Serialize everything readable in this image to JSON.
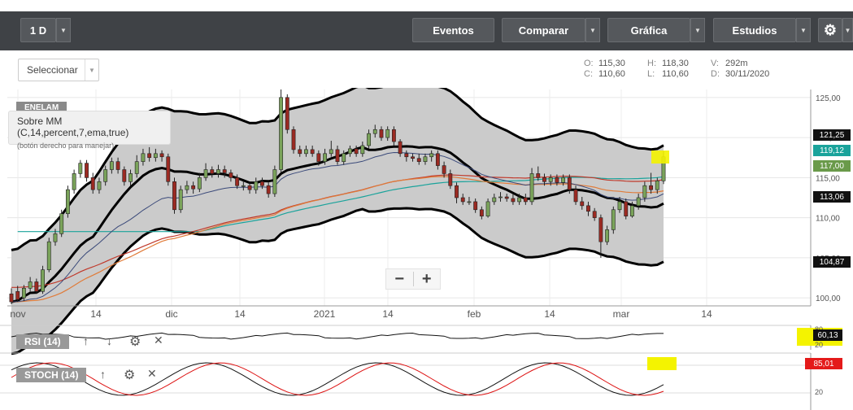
{
  "toolbar": {
    "interval": "1 D",
    "eventos": "Eventos",
    "comparar": "Comparar",
    "grafica": "Gráfica",
    "estudios": "Estudios"
  },
  "subbar": {
    "select_label": "Seleccionar",
    "ohlc": {
      "open_label": "O:",
      "open": "115,30",
      "high_label": "H:",
      "high": "118,30",
      "vol_label": "V:",
      "vol": "292m",
      "close_label": "C:",
      "close": "110,60",
      "low_label": "L:",
      "low": "110,60",
      "date_label": "D:",
      "date": "30/11/2020"
    }
  },
  "chart": {
    "symbol": "ENELAM",
    "tooltip_title": "Sobre MM (C,14,percent,7,ema,true)",
    "tooltip_hint": "(botón derecho para manejar)",
    "zoom_out": "−",
    "zoom_in": "+",
    "price_axis": [
      "125,00",
      "120,00",
      "115,00",
      "110,00",
      "105,00",
      "100,00"
    ],
    "date_axis": [
      "nov",
      "14",
      "dic",
      "14",
      "2021",
      "14",
      "feb",
      "14",
      "mar",
      "14"
    ],
    "price_tags": [
      {
        "label": "121,25",
        "color": "#111111"
      },
      {
        "label": "119,12",
        "color": "#1aa39b"
      },
      {
        "label": "117,00",
        "color": "#6a9a4a"
      },
      {
        "label": "113,06",
        "color": "#111111"
      },
      {
        "label": "104,87",
        "color": "#111111"
      }
    ]
  },
  "chart_data": {
    "type": "candlestick",
    "x_range": [
      "nov",
      "mar"
    ],
    "ylim": [
      99,
      126
    ],
    "candles": [
      [
        100.5,
        99.5,
        101.2,
        99.2
      ],
      [
        100.8,
        99.8,
        101.5,
        99.5
      ],
      [
        100.0,
        101.2,
        101.6,
        99.6
      ],
      [
        101.2,
        102.0,
        102.6,
        100.8
      ],
      [
        102.0,
        100.8,
        102.4,
        100.5
      ],
      [
        100.8,
        103.5,
        104.0,
        100.5
      ],
      [
        103.5,
        107.0,
        107.5,
        103.2
      ],
      [
        107.0,
        108.0,
        108.6,
        106.5
      ],
      [
        108.0,
        110.5,
        111.0,
        107.6
      ],
      [
        110.5,
        113.5,
        114.0,
        110.0
      ],
      [
        113.5,
        115.5,
        116.0,
        113.0
      ],
      [
        115.5,
        116.8,
        117.2,
        115.0
      ],
      [
        116.8,
        115.0,
        117.2,
        114.5
      ],
      [
        115.0,
        113.5,
        115.6,
        113.0
      ],
      [
        113.5,
        114.5,
        115.0,
        113.0
      ],
      [
        114.5,
        116.0,
        116.5,
        114.0
      ],
      [
        116.0,
        117.0,
        117.5,
        115.5
      ],
      [
        117.0,
        116.0,
        117.5,
        115.5
      ],
      [
        116.0,
        114.5,
        116.4,
        114.0
      ],
      [
        114.5,
        115.5,
        116.0,
        114.0
      ],
      [
        115.5,
        117.0,
        117.8,
        115.0
      ],
      [
        117.0,
        118.0,
        118.6,
        116.5
      ],
      [
        118.0,
        117.5,
        118.8,
        117.0
      ],
      [
        117.5,
        118.0,
        118.6,
        117.0
      ],
      [
        118.0,
        117.6,
        118.4,
        117.0
      ],
      [
        117.6,
        114.5,
        118.0,
        114.0
      ],
      [
        114.5,
        111.0,
        115.0,
        110.5
      ],
      [
        111.0,
        113.5,
        114.0,
        110.6
      ],
      [
        113.5,
        114.0,
        114.6,
        113.0
      ],
      [
        114.0,
        113.6,
        114.5,
        113.0
      ],
      [
        113.6,
        115.0,
        115.6,
        113.2
      ],
      [
        115.0,
        116.0,
        116.8,
        114.6
      ],
      [
        116.0,
        115.5,
        116.4,
        115.0
      ],
      [
        115.5,
        116.0,
        116.6,
        115.0
      ],
      [
        116.0,
        115.6,
        116.5,
        115.0
      ],
      [
        115.6,
        115.0,
        116.0,
        114.5
      ],
      [
        115.0,
        114.0,
        115.4,
        113.6
      ],
      [
        114.0,
        114.0,
        114.6,
        113.4
      ],
      [
        114.0,
        113.5,
        114.4,
        113.0
      ],
      [
        113.5,
        114.5,
        115.0,
        113.0
      ],
      [
        114.5,
        114.0,
        115.0,
        113.6
      ],
      [
        114.0,
        113.0,
        114.4,
        112.5
      ],
      [
        113.0,
        116.0,
        116.5,
        112.6
      ],
      [
        116.0,
        125.0,
        126.0,
        115.6
      ],
      [
        125.0,
        121.0,
        125.4,
        120.5
      ],
      [
        121.0,
        118.5,
        121.4,
        118.0
      ],
      [
        118.5,
        118.0,
        119.0,
        117.6
      ],
      [
        118.0,
        118.5,
        119.0,
        117.6
      ],
      [
        118.5,
        118.0,
        119.0,
        117.6
      ],
      [
        118.0,
        117.0,
        118.4,
        116.5
      ],
      [
        117.0,
        118.0,
        118.6,
        116.6
      ],
      [
        118.0,
        118.5,
        119.6,
        117.6
      ],
      [
        118.5,
        117.0,
        119.0,
        116.6
      ],
      [
        117.0,
        118.0,
        118.4,
        116.6
      ],
      [
        118.0,
        118.6,
        119.0,
        117.6
      ],
      [
        118.6,
        118.0,
        119.0,
        117.6
      ],
      [
        118.0,
        119.0,
        119.5,
        117.6
      ],
      [
        119.0,
        120.5,
        121.0,
        118.6
      ],
      [
        120.5,
        121.0,
        121.6,
        120.0
      ],
      [
        121.0,
        120.0,
        121.4,
        119.6
      ],
      [
        120.0,
        121.0,
        121.4,
        119.6
      ],
      [
        121.0,
        119.5,
        121.4,
        119.0
      ],
      [
        119.5,
        118.0,
        119.8,
        117.6
      ],
      [
        118.0,
        117.6,
        118.4,
        117.0
      ],
      [
        117.6,
        117.4,
        118.0,
        117.0
      ],
      [
        117.4,
        117.0,
        118.0,
        116.6
      ],
      [
        117.0,
        117.6,
        118.0,
        116.6
      ],
      [
        117.6,
        118.0,
        118.4,
        117.0
      ],
      [
        118.0,
        116.5,
        118.4,
        116.0
      ],
      [
        116.5,
        115.5,
        117.0,
        115.0
      ],
      [
        115.5,
        114.0,
        116.0,
        113.6
      ],
      [
        114.0,
        112.5,
        114.4,
        111.8
      ],
      [
        112.5,
        112.0,
        113.0,
        111.6
      ],
      [
        112.0,
        112.0,
        112.6,
        111.6
      ],
      [
        112.0,
        111.0,
        112.4,
        110.6
      ],
      [
        111.0,
        110.2,
        111.4,
        109.8
      ],
      [
        110.2,
        112.0,
        112.4,
        110.0
      ],
      [
        112.0,
        112.5,
        113.0,
        111.6
      ],
      [
        112.5,
        112.6,
        113.2,
        112.0
      ],
      [
        112.6,
        112.4,
        113.0,
        112.0
      ],
      [
        112.4,
        112.0,
        113.0,
        111.6
      ],
      [
        112.0,
        112.5,
        113.0,
        111.6
      ],
      [
        112.5,
        112.0,
        113.0,
        111.6
      ],
      [
        112.0,
        115.5,
        116.2,
        111.6
      ],
      [
        115.5,
        115.0,
        116.4,
        114.6
      ],
      [
        115.0,
        114.5,
        115.5,
        114.0
      ],
      [
        114.5,
        115.0,
        115.4,
        114.0
      ],
      [
        115.0,
        114.4,
        115.4,
        114.0
      ],
      [
        114.4,
        115.0,
        115.4,
        114.0
      ],
      [
        115.0,
        113.5,
        115.4,
        113.0
      ],
      [
        113.5,
        112.0,
        114.0,
        111.6
      ],
      [
        112.0,
        111.5,
        112.6,
        111.0
      ],
      [
        111.5,
        110.8,
        112.0,
        110.2
      ],
      [
        110.8,
        110.0,
        111.2,
        109.6
      ],
      [
        110.0,
        107.0,
        110.4,
        105.0
      ],
      [
        107.0,
        108.5,
        109.0,
        106.6
      ],
      [
        108.5,
        111.0,
        111.4,
        108.0
      ],
      [
        111.0,
        112.0,
        112.6,
        110.6
      ],
      [
        112.0,
        110.2,
        112.4,
        109.8
      ],
      [
        110.2,
        111.5,
        112.0,
        110.0
      ],
      [
        111.5,
        112.5,
        113.0,
        111.0
      ],
      [
        112.5,
        114.0,
        114.5,
        112.0
      ],
      [
        114.0,
        113.5,
        115.6,
        113.0
      ],
      [
        113.5,
        114.6,
        115.0,
        113.0
      ],
      [
        114.6,
        117.6,
        118.3,
        114.2
      ]
    ],
    "indicators": {
      "rsi": {
        "name": "RSI (14)",
        "last": "60,13"
      },
      "stoch": {
        "name": "STOCH (14)",
        "last": "85,01"
      }
    }
  },
  "rsi": {
    "label": "RSI (14)",
    "value": "60,13",
    "axis_top": "80",
    "axis_bottom": "20"
  },
  "stoch": {
    "label": "STOCH (14)",
    "value": "85,01",
    "axis_top": "80",
    "axis_bottom": "20"
  }
}
